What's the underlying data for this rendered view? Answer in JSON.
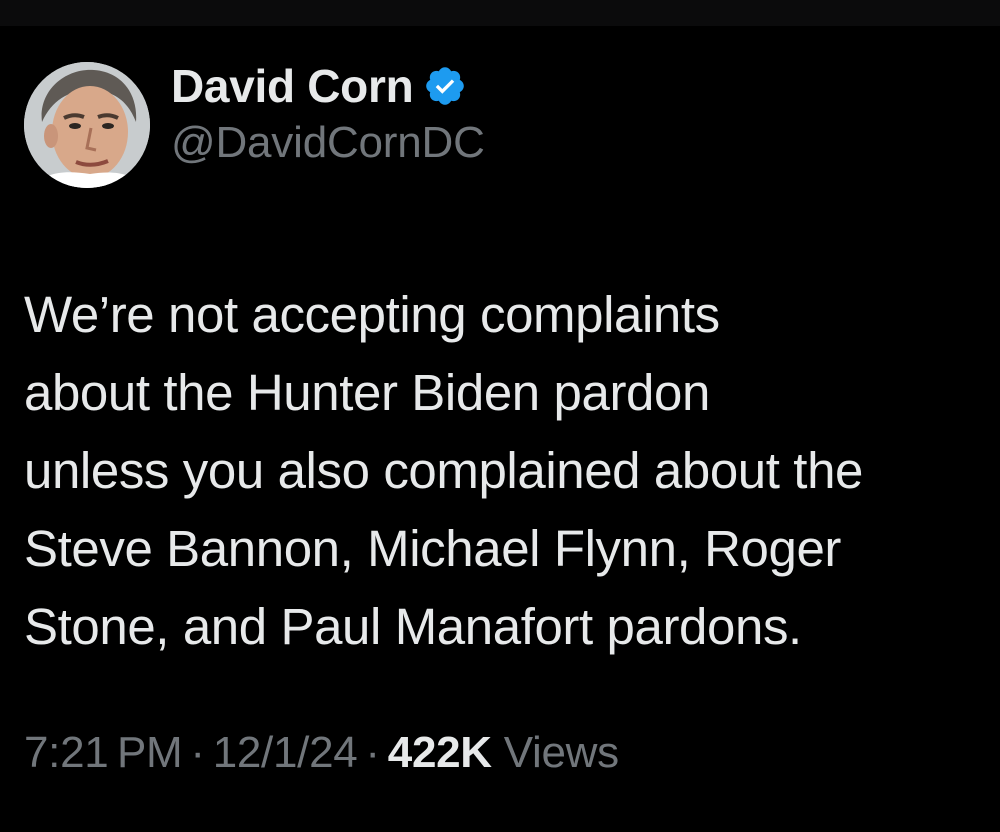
{
  "tweet": {
    "author": {
      "display_name": "David Corn",
      "handle": "@DavidCornDC",
      "verified_icon": "verified-badge-icon",
      "accent_color": "#1d9bf0"
    },
    "text_lines": [
      "We’re not accepting complaints",
      "about the Hunter Biden pardon",
      "unless you also complained about the",
      "Steve Bannon, Michael Flynn, Roger",
      "Stone, and Paul Manafort pardons."
    ],
    "meta": {
      "time": "7:21 PM",
      "separator": "·",
      "date": "12/1/24",
      "views_count": "422K",
      "views_label": "Views"
    }
  }
}
